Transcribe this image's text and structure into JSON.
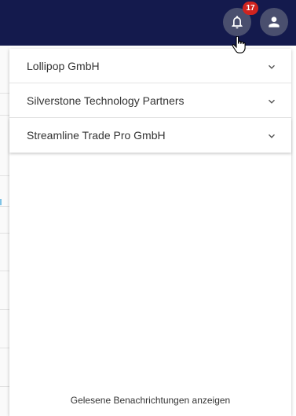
{
  "header": {
    "notification_count": "17",
    "bell_icon": "bell-icon",
    "user_icon": "person-icon",
    "colors": {
      "bar": "#141a4d",
      "button": "#4a4f6e",
      "badge": "#d0231f"
    }
  },
  "notifications": {
    "groups": [
      {
        "label": "Lollipop GmbH"
      },
      {
        "label": "Silverstone Technology Partners"
      },
      {
        "label": "Streamline Trade Pro GmbH"
      }
    ],
    "footer_link": "Gelesene Benachrichtungen anzeigen"
  }
}
